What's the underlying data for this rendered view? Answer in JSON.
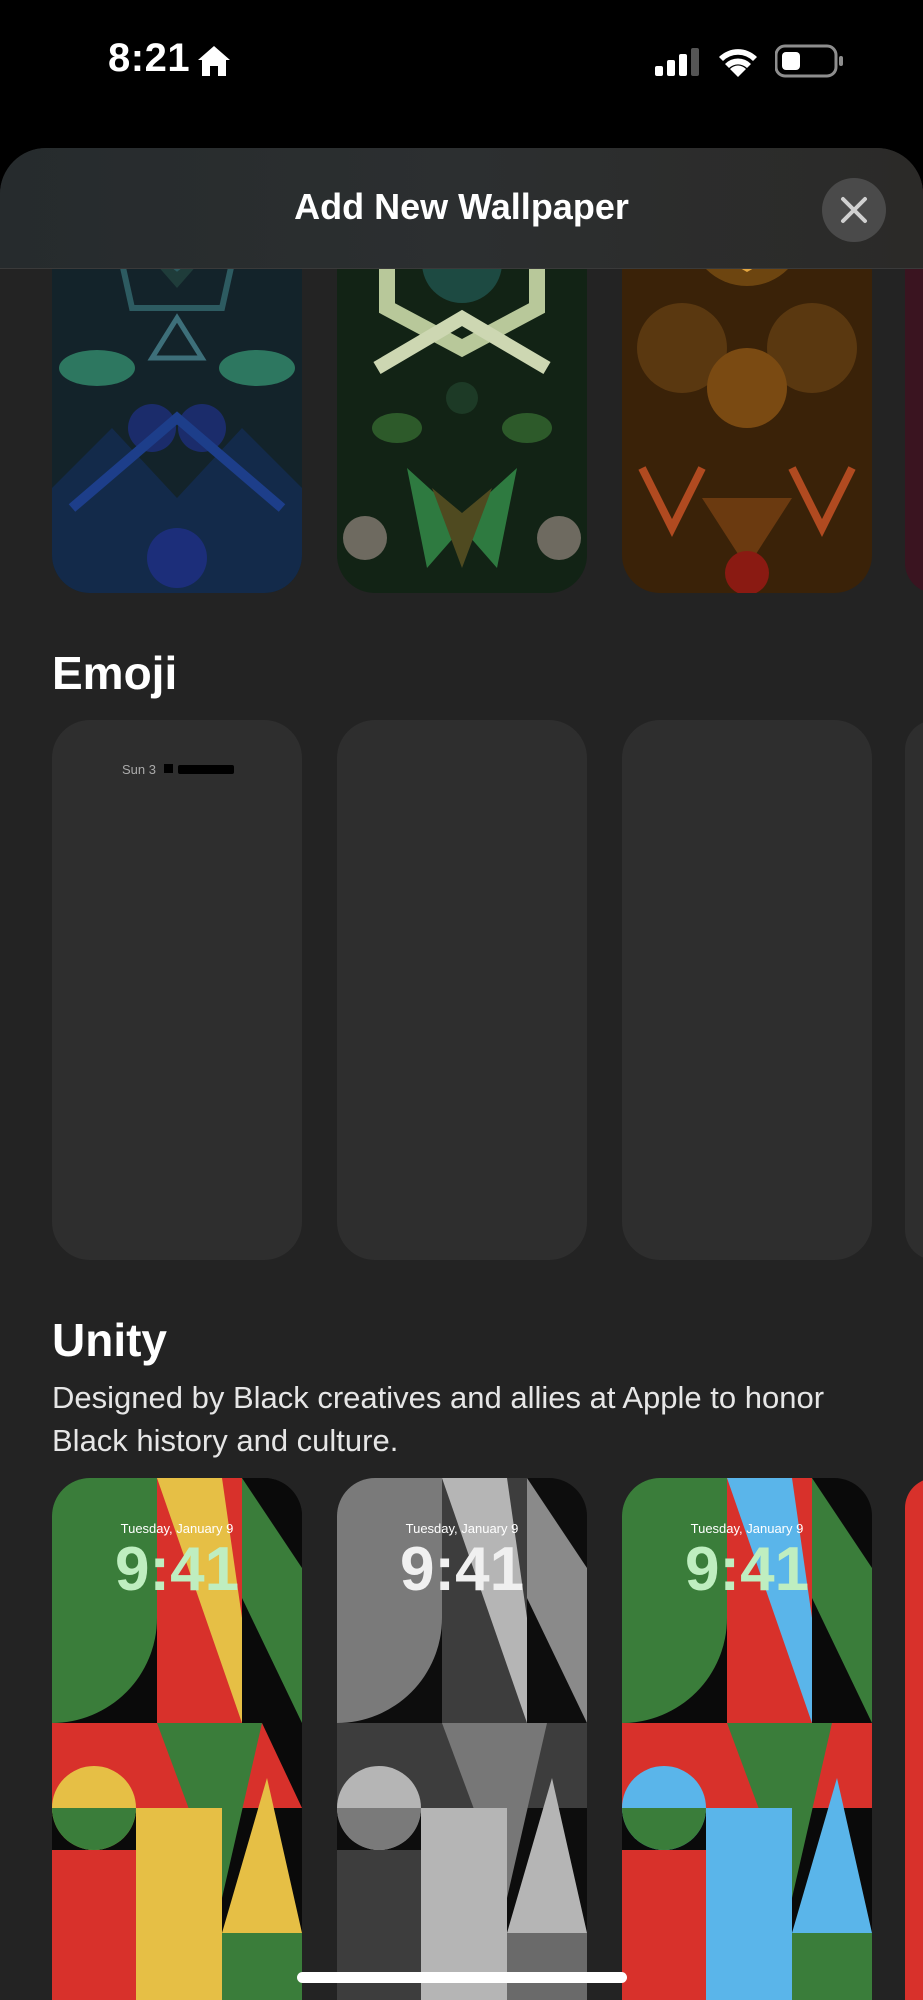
{
  "status_bar": {
    "time": "8:21"
  },
  "sheet": {
    "title": "Add New Wallpaper"
  },
  "sections": {
    "emoji": {
      "title": "Emoji",
      "preview_date": "Sun 3"
    },
    "unity": {
      "title": "Unity",
      "description": "Designed by Black creatives and allies at Apple to honor Black history and culture.",
      "tiles": [
        {
          "date": "Tuesday, January 9",
          "time": "9:41",
          "palette": "green-red-yellow"
        },
        {
          "date": "Tuesday, January 9",
          "time": "9:41",
          "palette": "grayscale"
        },
        {
          "date": "Tuesday, January 9",
          "time": "9:41",
          "palette": "green-red-blue"
        }
      ]
    }
  },
  "colors": {
    "unity_green": "#3a7d3a",
    "unity_red": "#d8312b",
    "unity_yellow": "#e6bf45",
    "unity_blue": "#5ab5ea",
    "sheet_bg": "#232323"
  }
}
